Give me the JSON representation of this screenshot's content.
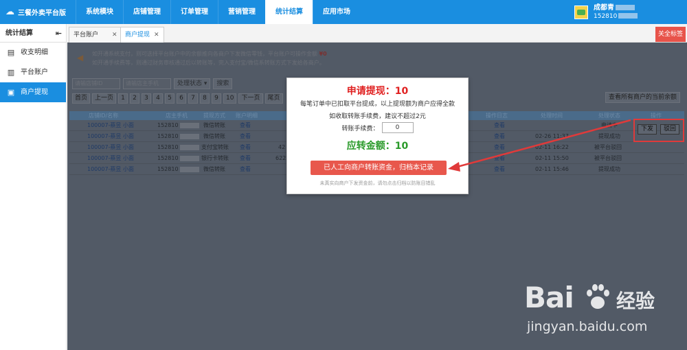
{
  "app": {
    "logo_text": "三餐外卖平台版"
  },
  "topnav": [
    {
      "label": "系统模块"
    },
    {
      "label": "店铺管理"
    },
    {
      "label": "订单管理"
    },
    {
      "label": "营销管理"
    },
    {
      "label": "统计结算"
    },
    {
      "label": "应用市场"
    }
  ],
  "user": {
    "name": "成都青",
    "phone": "152810"
  },
  "sidebar": {
    "title": "统计结算",
    "items": [
      {
        "label": "收支明细"
      },
      {
        "label": "平台账户"
      },
      {
        "label": "商户提现"
      }
    ]
  },
  "tabs": [
    {
      "label": "平台账户"
    },
    {
      "label": "商户提现"
    }
  ],
  "close_all": "关全标签",
  "notice": {
    "line1": "如开通系统支付，则可选择平台账户中的余额推向各商户下发微信零钱，平台账户可操作金额",
    "amount": "¥0",
    "line2": "如开通手续费等，则通过财务审核通过后以转账等，完入支付宝/微信系转账方式下发给各商户。"
  },
  "search": {
    "store_placeholder": "请输店铺ID",
    "phone_placeholder": "请输店主手机",
    "status_label": "处理状态",
    "button": "搜索"
  },
  "pager": {
    "first": "首页",
    "prev": "上一页",
    "pages": [
      "1",
      "2",
      "3",
      "4",
      "5",
      "6",
      "7",
      "8",
      "9",
      "10"
    ],
    "next": "下一页",
    "last": "尾页"
  },
  "view_all": "查看所有商户的当前余额",
  "table": {
    "headers": [
      "店铺ID/名称",
      "店主手机",
      "提现方式",
      "账户明细",
      "",
      "",
      "",
      "操作日志",
      "处理时间",
      "处理状态",
      "操作"
    ],
    "rows": [
      {
        "store": "100007-蔡昱 小面",
        "phone": "152810",
        "method": "微信转账",
        "view": "查看",
        "acct": "",
        "log": "查看",
        "time": "",
        "status": "申请中"
      },
      {
        "store": "100007-蔡昱 小面",
        "phone": "152810",
        "method": "微信转账",
        "view": "查看",
        "acct": "",
        "log": "查看",
        "time": "02-26 11:37",
        "status": "提现成功"
      },
      {
        "store": "100007-蔡昱 小面",
        "phone": "152810",
        "method": "支付宝转账",
        "view": "查看",
        "acct": "42",
        "log": "查看",
        "time": "02-11 16:22",
        "status": "被平台驳回"
      },
      {
        "store": "100007-蔡昱 小面",
        "phone": "152810",
        "method": "银行卡转账",
        "view": "查看",
        "acct": "6222",
        "log": "查看",
        "time": "02-11 15:50",
        "status": "被平台驳回"
      },
      {
        "store": "100007-蔡昱 小面",
        "phone": "152810",
        "method": "微信转账",
        "view": "查看",
        "acct": "",
        "log": "查看",
        "time": "02-11 15:46",
        "status": "提现成功"
      }
    ]
  },
  "row_actions": {
    "issue": "下发",
    "reject": "驳回"
  },
  "modal": {
    "title": "申请提现：10",
    "line1": "每笔订单中已扣取平台提成，以上提现额为商户应得全款",
    "line2": "如收取转账手续费，建议不超过2元",
    "fee_label": "转账手续费：",
    "fee_value": "0",
    "total": "应转金额：10",
    "button": "已人工向商户转账资金，归档本记录",
    "tip": "未真实向商户下发资金前，请勿点击归档以防账目错乱"
  },
  "watermark": {
    "brand": "Bai",
    "brand2": "经验",
    "url": "jingyan.baidu.com"
  }
}
